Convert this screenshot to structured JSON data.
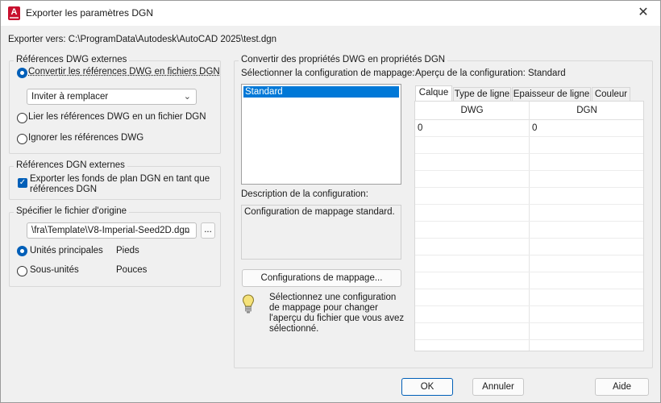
{
  "window": {
    "title": "Exporter les paramètres DGN",
    "app_icon": "autocad-icon",
    "app_icon_letter": "A",
    "close_label": "✕"
  },
  "export_path": "Exporter vers: C:\\ProgramData\\Autodesk\\AutoCAD 2025\\test.dgn",
  "dwg_refs": {
    "legend": "Références DWG externes",
    "option_convert": "Convertir les références DWG en fichiers DGN",
    "combo_value": "Inviter à remplacer",
    "option_link": "Lier les références DWG en un fichier DGN",
    "option_ignore": "Ignorer les références DWG",
    "selected": "convert"
  },
  "dgn_refs": {
    "legend": "Références DGN externes",
    "checkbox_label_line1": "Exporter les fonds de plan DGN en tant que",
    "checkbox_label_line2": "références DGN",
    "checked": true
  },
  "seed": {
    "legend": "Spécifier le fichier d'origine",
    "file_value": "\\fra\\Template\\V8-Imperial-Seed2D.dgn",
    "browse_label": "...",
    "units_main_label": "Unités principales",
    "units_main_value": "Pieds",
    "units_sub_label": "Sous-unités",
    "units_sub_value": "Pouces",
    "selected": "main"
  },
  "convert": {
    "legend": "Convertir des propriétés DWG en propriétés DGN",
    "select_label": "Sélectionner la configuration de mappage:",
    "configs": [
      "Standard"
    ],
    "selected_config": "Standard",
    "desc_label": "Description de la configuration:",
    "desc_text": "Configuration de mappage standard.",
    "mapping_button": "Configurations de mappage...",
    "hint_line1": "Sélectionnez une configuration",
    "hint_line2": "de mappage pour changer",
    "hint_line3": "l'aperçu du fichier que vous avez",
    "hint_line4": "sélectionné.",
    "preview_label": "Aperçu de la configuration: Standard",
    "tabs": [
      "Calque",
      "Type de ligne",
      "Epaisseur de ligne",
      "Couleur"
    ],
    "active_tab": "Calque",
    "columns": [
      "DWG",
      "DGN"
    ],
    "rows": [
      [
        "0",
        "0"
      ]
    ]
  },
  "footer": {
    "ok": "OK",
    "cancel": "Annuler",
    "help": "Aide"
  },
  "colors": {
    "accent": "#005fb8",
    "selection": "#0078d7",
    "brand": "#c8102e"
  }
}
